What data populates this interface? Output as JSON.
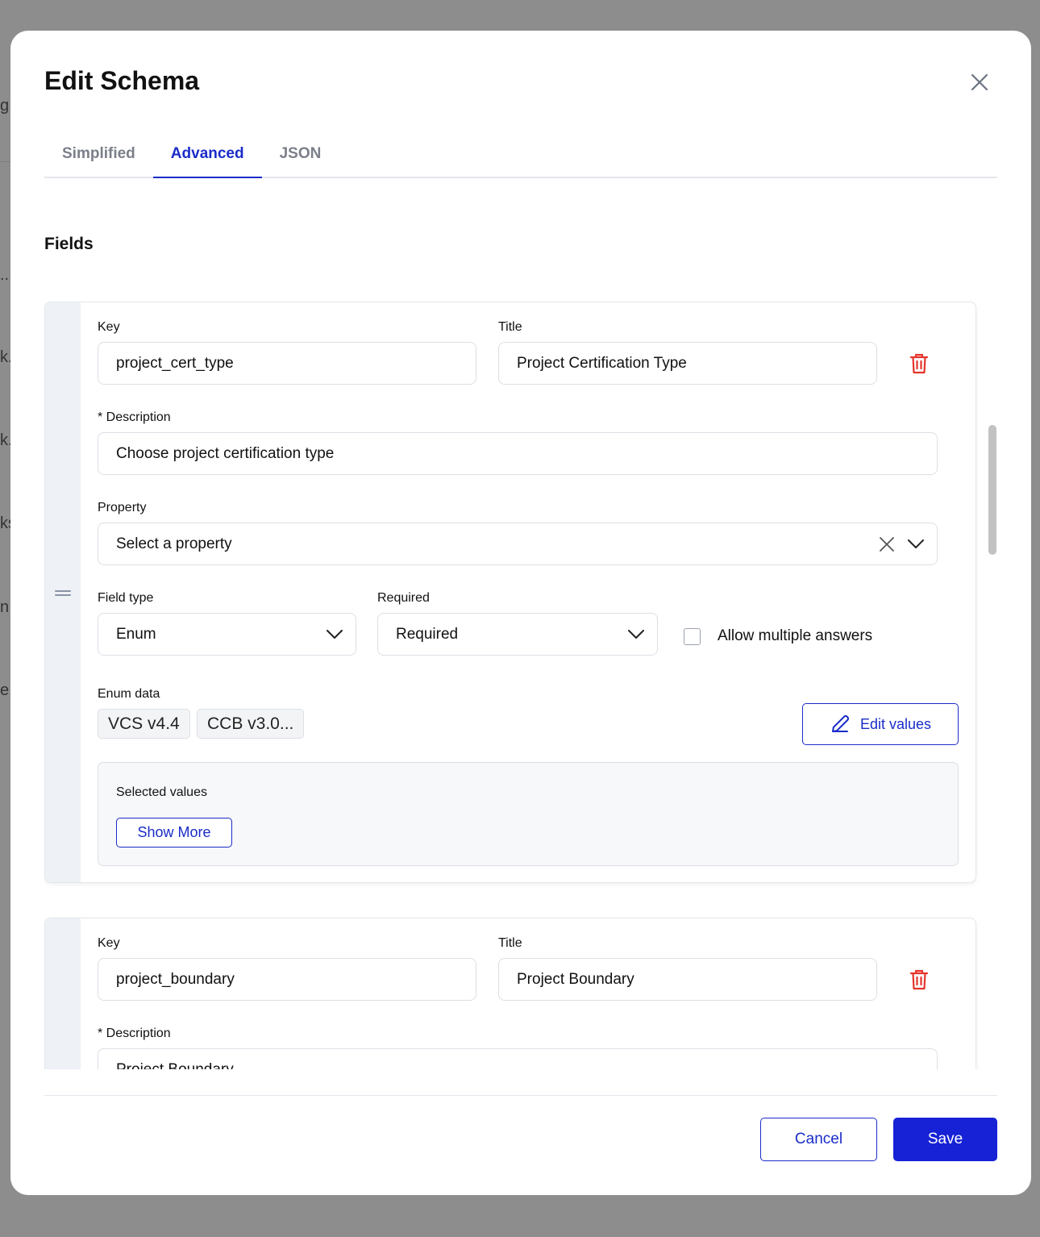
{
  "background": {
    "fragments": [
      "g",
      "...",
      "k.",
      "k.",
      "ks",
      "n",
      "e..."
    ]
  },
  "modal": {
    "title": "Edit Schema",
    "close_icon": "close-icon"
  },
  "tabs": [
    {
      "label": "Simplified",
      "active": false
    },
    {
      "label": "Advanced",
      "active": true
    },
    {
      "label": "JSON",
      "active": false
    }
  ],
  "section_title": "Fields",
  "fields": [
    {
      "key_label": "Key",
      "key_value": "project_cert_type",
      "title_label": "Title",
      "title_value": "Project Certification Type",
      "description_label": "* Description",
      "description_value": "Choose project certification type",
      "property_label": "Property",
      "property_placeholder": "Select a property",
      "field_type_label": "Field type",
      "field_type_value": "Enum",
      "required_label": "Required",
      "required_value": "Required",
      "allow_multiple_label": "Allow multiple answers",
      "allow_multiple_checked": false,
      "enum_data_label": "Enum data",
      "enum_values": [
        "VCS v4.4",
        "CCB v3.0..."
      ],
      "edit_values_label": "Edit values",
      "selected_values_label": "Selected values",
      "show_more_label": "Show More"
    },
    {
      "key_label": "Key",
      "key_value": "project_boundary",
      "title_label": "Title",
      "title_value": "Project Boundary",
      "description_label": "* Description",
      "description_value": "Project Boundary"
    }
  ],
  "footer": {
    "cancel_label": "Cancel",
    "save_label": "Save"
  },
  "colors": {
    "accent": "#1a2cc9",
    "save_bg": "#1722d6",
    "delete": "#e5352b"
  }
}
